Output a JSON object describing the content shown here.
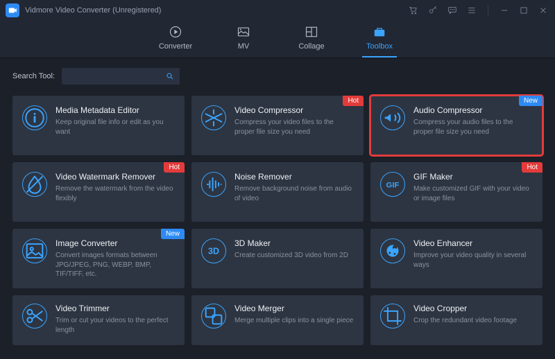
{
  "app": {
    "title": "Vidmore Video Converter (Unregistered)"
  },
  "tabs": [
    {
      "id": "converter",
      "label": "Converter"
    },
    {
      "id": "mv",
      "label": "MV"
    },
    {
      "id": "collage",
      "label": "Collage"
    },
    {
      "id": "toolbox",
      "label": "Toolbox",
      "active": true
    }
  ],
  "search": {
    "label": "Search Tool:",
    "value": ""
  },
  "badges": {
    "hot": "Hot",
    "new": "New"
  },
  "tools": [
    {
      "id": "media-metadata-editor",
      "title": "Media Metadata Editor",
      "desc": "Keep original file info or edit as you want"
    },
    {
      "id": "video-compressor",
      "title": "Video Compressor",
      "desc": "Compress your video files to the proper file size you need",
      "badge": "hot"
    },
    {
      "id": "audio-compressor",
      "title": "Audio Compressor",
      "desc": "Compress your audio files to the proper file size you need",
      "badge": "new",
      "highlight": true
    },
    {
      "id": "video-watermark-remover",
      "title": "Video Watermark Remover",
      "desc": "Remove the watermark from the video flexibly",
      "badge": "hot"
    },
    {
      "id": "noise-remover",
      "title": "Noise Remover",
      "desc": "Remove background noise from audio of video"
    },
    {
      "id": "gif-maker",
      "title": "GIF Maker",
      "desc": "Make customized GIF with your video or image files",
      "badge": "hot"
    },
    {
      "id": "image-converter",
      "title": "Image Converter",
      "desc": "Convert images formats between JPG/JPEG, PNG, WEBP, BMP, TIF/TIFF, etc.",
      "badge": "new"
    },
    {
      "id": "3d-maker",
      "title": "3D Maker",
      "desc": "Create customized 3D video from 2D"
    },
    {
      "id": "video-enhancer",
      "title": "Video Enhancer",
      "desc": "Improve your video quality in several ways"
    },
    {
      "id": "video-trimmer",
      "title": "Video Trimmer",
      "desc": "Trim or cut your videos to the perfect length"
    },
    {
      "id": "video-merger",
      "title": "Video Merger",
      "desc": "Merge multiple clips into a single piece"
    },
    {
      "id": "video-cropper",
      "title": "Video Cropper",
      "desc": "Crop the redundant video footage"
    }
  ]
}
